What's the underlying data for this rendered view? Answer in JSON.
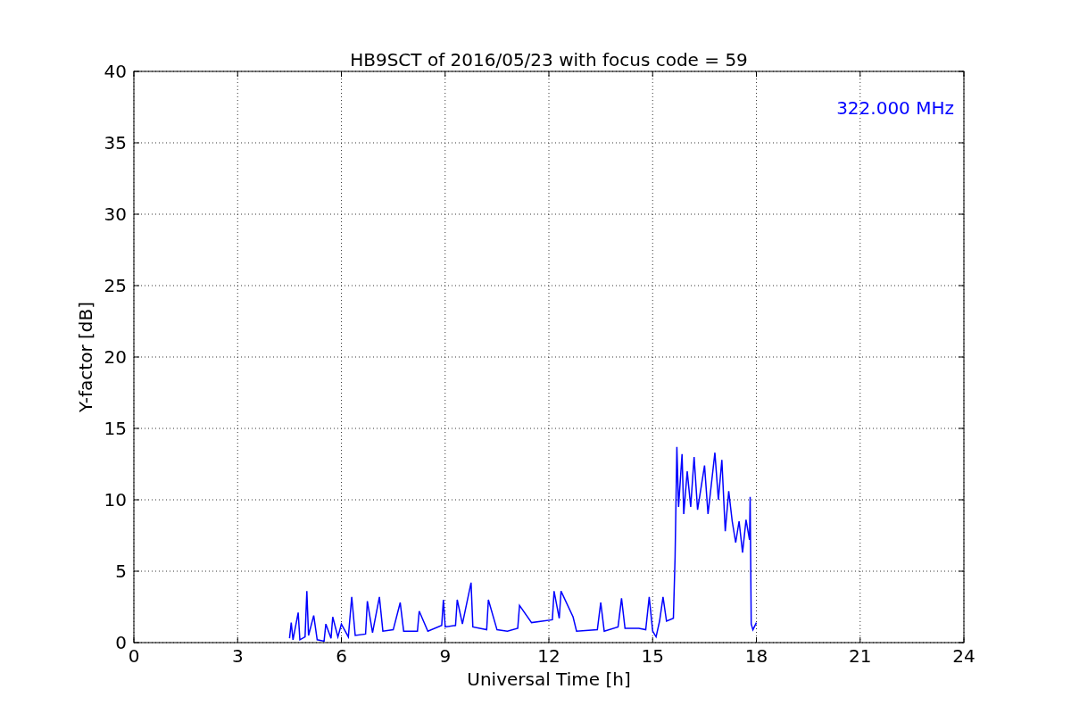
{
  "chart_data": {
    "type": "line",
    "title": "HB9SCT of 2016/05/23 with focus code = 59",
    "xlabel": "Universal Time [h]",
    "ylabel": "Y-factor [dB]",
    "x": [
      4.5,
      4.55,
      4.6,
      4.75,
      4.8,
      4.95,
      5.0,
      5.05,
      5.2,
      5.3,
      5.5,
      5.55,
      5.7,
      5.75,
      5.9,
      6.0,
      6.2,
      6.3,
      6.4,
      6.7,
      6.75,
      6.9,
      7.1,
      7.2,
      7.5,
      7.7,
      7.8,
      8.2,
      8.25,
      8.5,
      8.9,
      8.95,
      9.0,
      9.3,
      9.35,
      9.5,
      9.75,
      9.8,
      10.2,
      10.25,
      10.5,
      10.8,
      11.1,
      11.15,
      11.5,
      11.8,
      12.1,
      12.15,
      12.3,
      12.35,
      12.7,
      12.8,
      13.4,
      13.5,
      13.6,
      14.0,
      14.1,
      14.2,
      14.6,
      14.8,
      14.9,
      15.0,
      15.1,
      15.2,
      15.3,
      15.4,
      15.6,
      15.65,
      15.7,
      15.75,
      15.85,
      15.9,
      16.0,
      16.1,
      16.2,
      16.3,
      16.5,
      16.6,
      16.8,
      16.9,
      17.0,
      17.1,
      17.2,
      17.3,
      17.4,
      17.5,
      17.6,
      17.7,
      17.8,
      17.82,
      17.85,
      17.9,
      18.0
    ],
    "series": [
      {
        "name": "322.000 MHz",
        "color": "#0000ff",
        "values": [
          0.3,
          1.4,
          0.2,
          2.1,
          0.2,
          0.4,
          3.6,
          0.5,
          1.9,
          0.2,
          0.1,
          1.3,
          0.3,
          1.8,
          0.4,
          1.3,
          0.4,
          3.2,
          0.5,
          0.6,
          2.9,
          0.7,
          3.2,
          0.8,
          0.9,
          2.8,
          0.8,
          0.8,
          2.2,
          0.8,
          1.2,
          3.0,
          1.1,
          1.2,
          3.0,
          1.3,
          4.2,
          1.1,
          0.9,
          3.0,
          0.9,
          0.8,
          1.0,
          2.6,
          1.4,
          1.5,
          1.6,
          3.6,
          1.7,
          3.6,
          1.8,
          0.8,
          0.9,
          2.8,
          0.8,
          1.1,
          3.1,
          1.0,
          1.0,
          0.9,
          3.2,
          0.8,
          0.4,
          1.5,
          3.2,
          1.5,
          1.7,
          6.0,
          13.7,
          9.5,
          13.2,
          9.0,
          12.0,
          9.5,
          13.0,
          9.3,
          12.4,
          9.0,
          13.3,
          10.0,
          12.8,
          7.8,
          10.6,
          8.5,
          7.0,
          8.5,
          6.3,
          8.6,
          7.2,
          10.2,
          1.3,
          0.9,
          1.4
        ]
      }
    ],
    "xlim": [
      0,
      24
    ],
    "ylim": [
      0,
      40
    ],
    "xticks": [
      0,
      3,
      6,
      9,
      12,
      15,
      18,
      21,
      24
    ],
    "yticks": [
      0,
      5,
      10,
      15,
      20,
      25,
      30,
      35,
      40
    ],
    "grid": true
  }
}
